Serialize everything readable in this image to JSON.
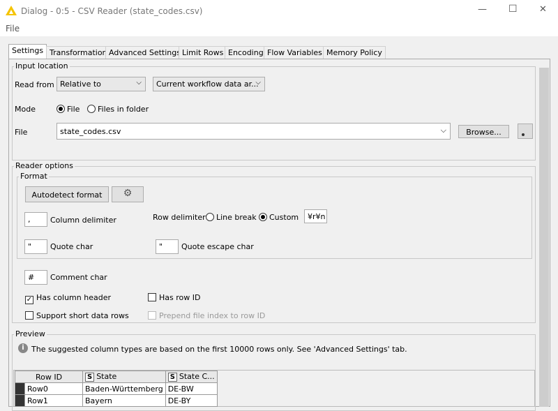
{
  "window": {
    "title": "Dialog - 0:5 - CSV Reader (state_codes.csv)",
    "minimize": "—",
    "maximize": "☐",
    "close": "✕",
    "icon_color": "#f5c400"
  },
  "menu": {
    "file": "File"
  },
  "tabs": [
    "Settings",
    "Transformation",
    "Advanced Settings",
    "Limit Rows",
    "Encoding",
    "Flow Variables",
    "Memory Policy"
  ],
  "input_location": {
    "title": "Input location",
    "read_from_label": "Read from",
    "read_from_value": "Relative to",
    "area_value": "Current workflow data ar...",
    "mode_label": "Mode",
    "mode_file": "File",
    "mode_folder": "Files in folder",
    "file_label": "File",
    "file_value": "state_codes.csv",
    "browse": "Browse..."
  },
  "reader_options": {
    "title": "Reader options",
    "format_title": "Format",
    "autodetect": "Autodetect format",
    "column_delimiter_value": ",",
    "column_delimiter_label": "Column delimiter",
    "row_delimiter_label": "Row delimiter",
    "line_break": "Line break",
    "custom": "Custom",
    "custom_value": "¥r¥n",
    "quote_char_value": "\"",
    "quote_char_label": "Quote char",
    "quote_escape_value": "\"",
    "quote_escape_label": "Quote escape char",
    "comment_value": "#",
    "comment_label": "Comment char",
    "has_column_header": "Has column header",
    "has_row_id": "Has row ID",
    "support_short": "Support short data rows",
    "prepend_file_index": "Prepend file index to row ID"
  },
  "preview": {
    "title": "Preview",
    "info": "The suggested column types are based on the first 10000 rows only. See 'Advanced Settings' tab.",
    "columns": [
      "Row ID",
      "State",
      "State C..."
    ],
    "type_badge": "S",
    "rows": [
      [
        "Row0",
        "Baden-Württemberg",
        "DE-BW"
      ],
      [
        "Row1",
        "Bayern",
        "DE-BY"
      ]
    ]
  }
}
